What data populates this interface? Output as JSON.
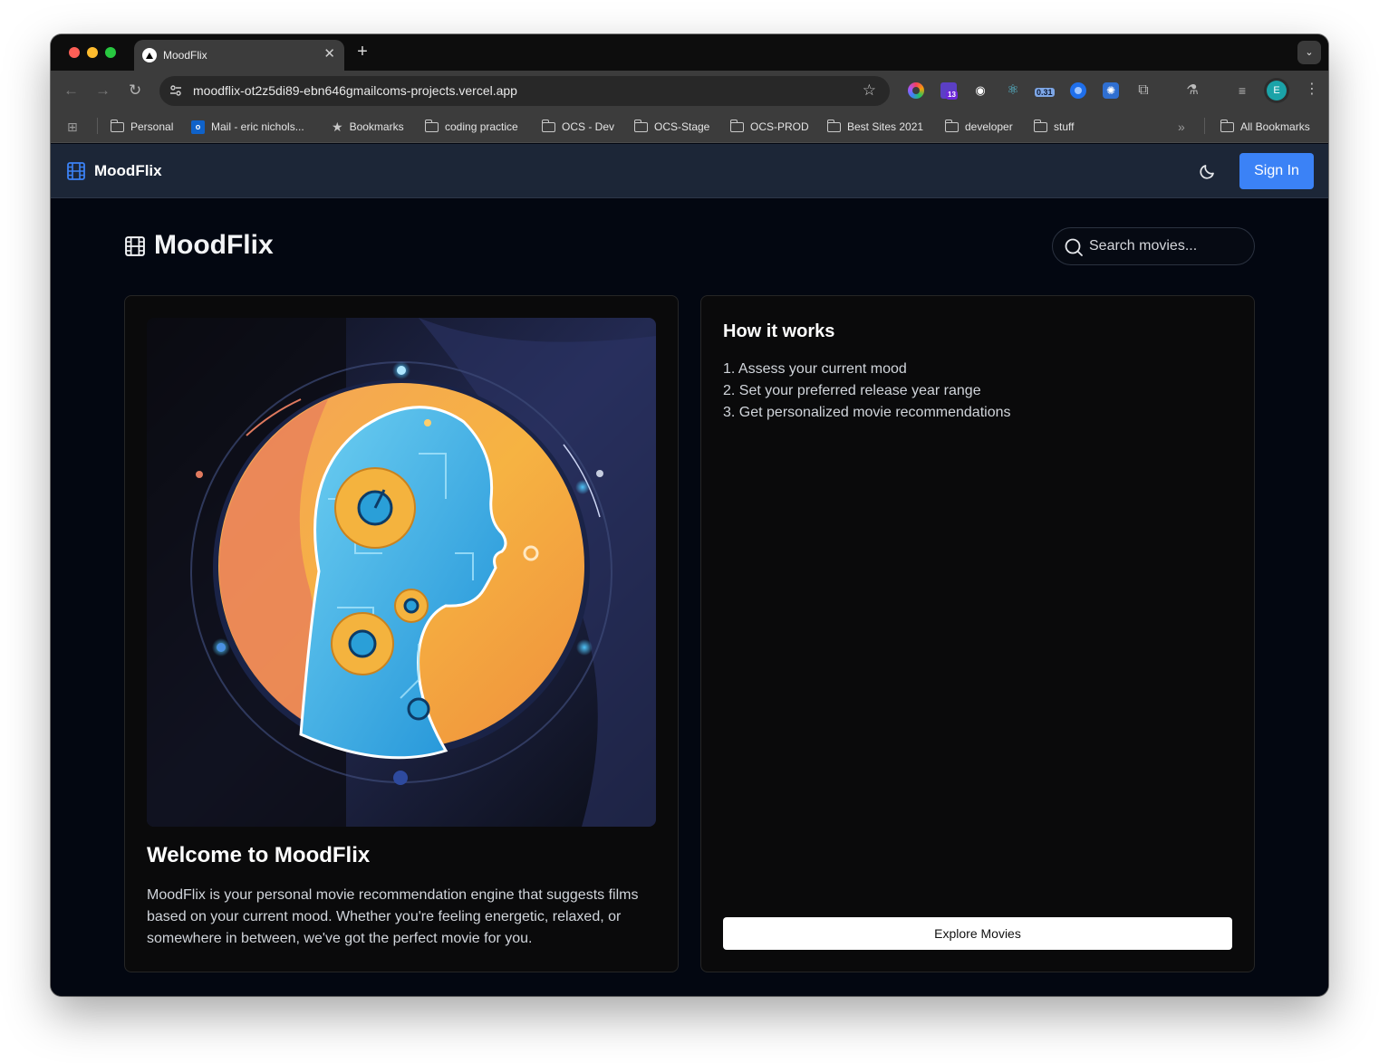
{
  "browser": {
    "tab_title": "MoodFlix",
    "tab_close": "✕",
    "new_tab": "+",
    "tab_search": "⌄",
    "url": "moodflix-ot2z5di89-ebn646gmailcoms-projects.vercel.app",
    "profile_initial": "E",
    "extension_badges": {
      "purple": "13",
      "timer": "0.31"
    },
    "bookmarks": [
      {
        "label": "Personal",
        "icon": "folder-icon"
      },
      {
        "label": "Mail - eric nichols...",
        "icon": "outlook-icon"
      },
      {
        "label": "Bookmarks",
        "icon": "star-icon"
      },
      {
        "label": "coding practice",
        "icon": "folder-icon"
      },
      {
        "label": "OCS - Dev",
        "icon": "folder-icon"
      },
      {
        "label": "OCS-Stage",
        "icon": "folder-icon"
      },
      {
        "label": "OCS-PROD",
        "icon": "folder-icon"
      },
      {
        "label": "Best Sites 2021",
        "icon": "folder-icon"
      },
      {
        "label": "developer",
        "icon": "folder-icon"
      },
      {
        "label": "stuff",
        "icon": "folder-icon"
      }
    ],
    "all_bookmarks": "All Bookmarks"
  },
  "app": {
    "brand": "MoodFlix",
    "sign_in": "Sign In",
    "page_title": "MoodFlix",
    "search_placeholder": "Search movies...",
    "welcome": {
      "title": "Welcome to MoodFlix",
      "body": "MoodFlix is your personal movie recommendation engine that suggests films based on your current mood. Whether you're feeling energetic, relaxed, or somewhere in between, we've got the perfect movie for you."
    },
    "how_it_works": {
      "title": "How it works",
      "steps": [
        "1. Assess your current mood",
        "2. Set your preferred release year range",
        "3. Get personalized movie recommendations"
      ],
      "button": "Explore Movies"
    }
  },
  "colors": {
    "accent": "#3b82f6",
    "header_bg": "#1c2637",
    "page_bg": "#030711",
    "card_bg": "#0a0a0b"
  }
}
